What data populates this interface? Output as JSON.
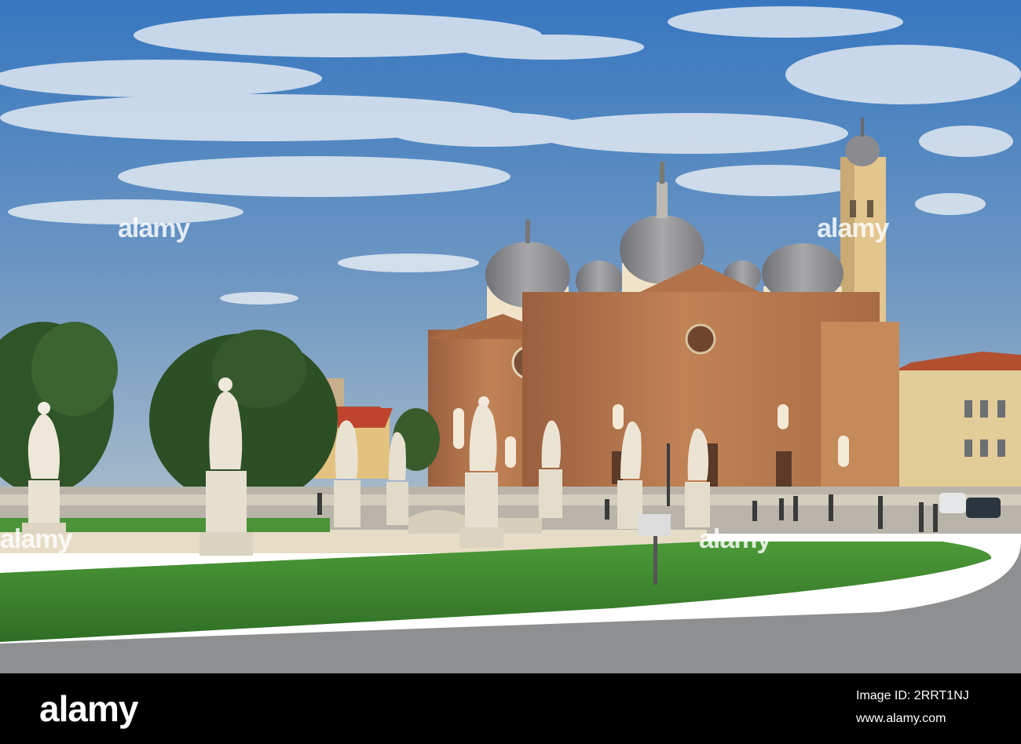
{
  "photo": {
    "scene": "Basilica of Santa Giustina with statues on Prato della Valle",
    "colors": {
      "sky_top": "#3f7fc4",
      "sky_bottom": "#9bb3c9",
      "cloud": "#e9eef3",
      "brick": "#b2734a",
      "brick_shadow": "#8a5538",
      "dome": "#8f8f94",
      "tower": "#e1c48f",
      "statue": "#e8e2d6",
      "grass": "#3f8a30",
      "tree": "#2f5226",
      "road": "#8b8d8e"
    }
  },
  "watermark": {
    "tile_text": "alamy"
  },
  "footer": {
    "logo": "alamy",
    "image_id": "Image ID: 2RRT1NJ",
    "url": "www.alamy.com"
  }
}
